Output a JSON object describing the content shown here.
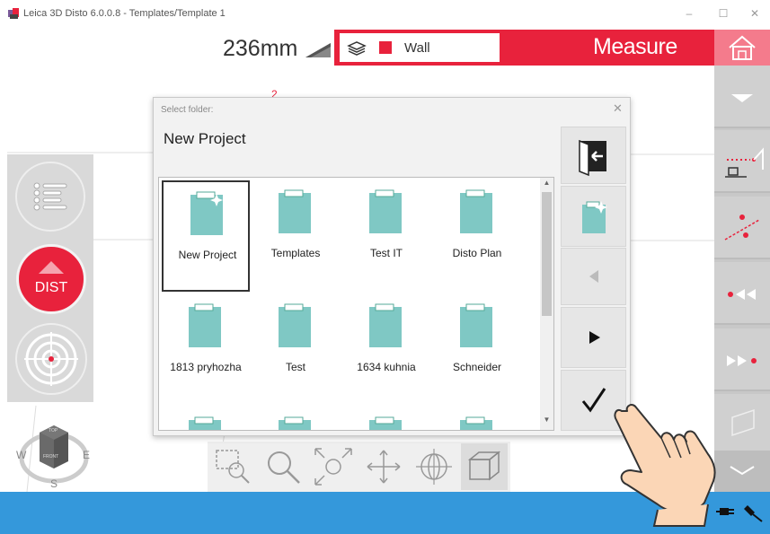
{
  "window": {
    "title": "Leica 3D Disto 6.0.0.8 - Templates/Template 1",
    "controls": [
      "–",
      "☐",
      "✕"
    ]
  },
  "toolbar": {
    "measure_value": "236mm",
    "layer_name": "Wall",
    "mode_label": "Measure"
  },
  "canvas": {
    "marker": "2"
  },
  "left_panel": {
    "dist_label": "DIST"
  },
  "compass": {
    "w": "W",
    "e": "E",
    "s": "S",
    "top": "TOP",
    "front": "FRONT"
  },
  "dialog": {
    "title": "Select folder:",
    "close": "✕",
    "heading": "New Project",
    "folders": [
      "New Project",
      "Templates",
      "Test IT",
      "Disto Plan",
      "1813 pryhozha",
      "Test",
      "1634 kuhnia",
      "Schneider"
    ],
    "scroll_up": "▲",
    "scroll_down": "▼"
  },
  "colors": {
    "brand_red": "#e8223c",
    "folder_teal": "#7fc8c4",
    "status_blue": "#3498db"
  },
  "icons": {
    "exit": "exit-icon",
    "new_folder": "new-folder-icon",
    "prev": "triangle-left-icon",
    "next": "triangle-right-icon",
    "confirm": "checkmark-icon"
  }
}
